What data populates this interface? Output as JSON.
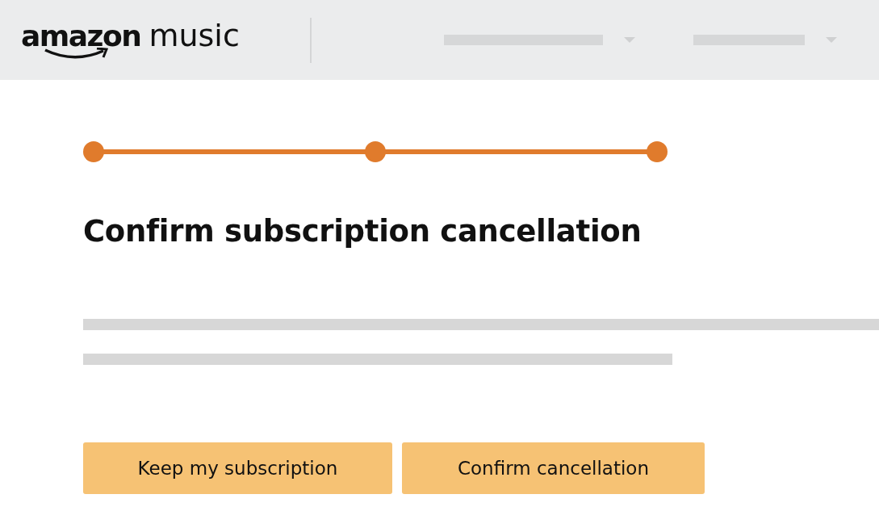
{
  "header": {
    "logo": {
      "brand": "amazon",
      "product": "music"
    }
  },
  "progress": {
    "steps": [
      {
        "completed": true
      },
      {
        "completed": true
      },
      {
        "completed": true
      }
    ]
  },
  "title": "Confirm subscription cancellation",
  "buttons": [
    {
      "label": "Keep my subscription"
    },
    {
      "label": "Confirm cancellation"
    }
  ]
}
